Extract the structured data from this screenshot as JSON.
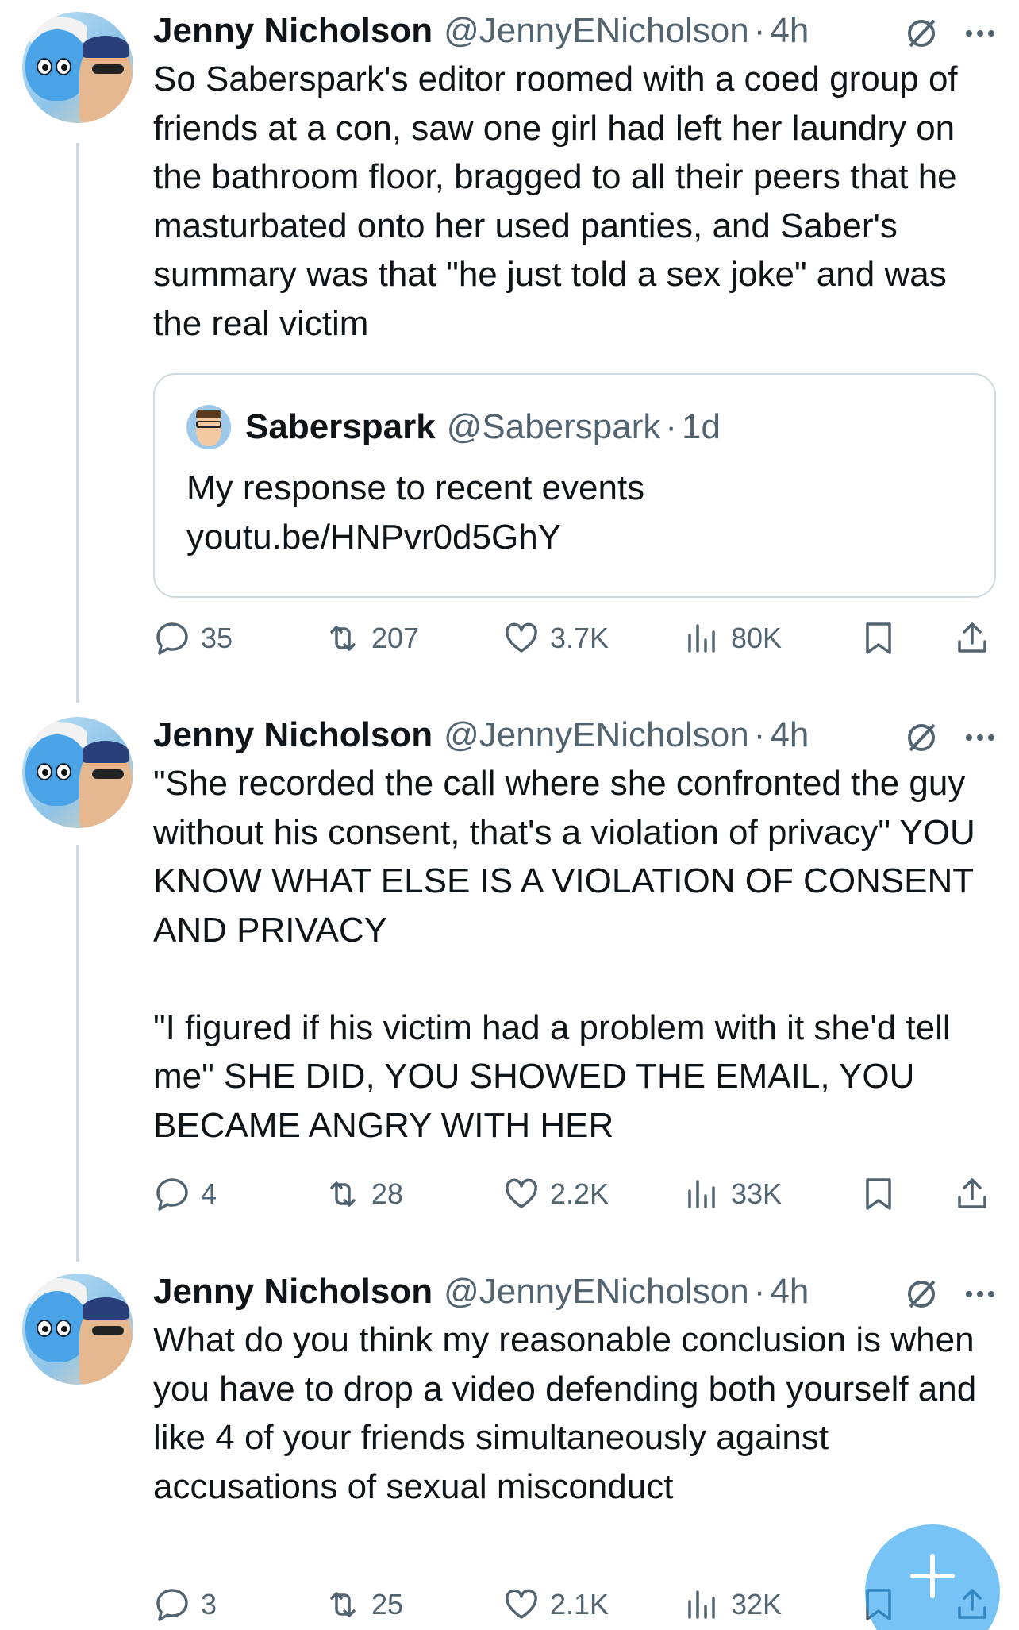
{
  "tweets": [
    {
      "author": "Jenny Nicholson",
      "handle": "@JennyENicholson",
      "separator": "·",
      "time": "4h",
      "text": "So Saberspark's editor roomed with a coed group of friends at a con, saw one girl had left her laundry on the bathroom floor, bragged to all their peers that he masturbated onto her used panties, and Saber's summary was that \"he just told a sex joke\" and was the real victim",
      "quote": {
        "author": "Saberspark",
        "handle": "@Saberspark",
        "separator": "·",
        "time": "1d",
        "text": "My response to recent events\nyoutu.be/HNPvr0d5GhY"
      },
      "stats": {
        "replies": "35",
        "reposts": "207",
        "likes": "3.7K",
        "views": "80K"
      }
    },
    {
      "author": "Jenny Nicholson",
      "handle": "@JennyENicholson",
      "separator": "·",
      "time": "4h",
      "text": "\"She recorded the call where she confronted the guy without his consent, that's a violation of privacy\" YOU KNOW WHAT ELSE IS A VIOLATION OF CONSENT AND PRIVACY\n\n\"I figured if his victim had a problem with it she'd tell me\" SHE DID, YOU SHOWED THE EMAIL, YOU BECAME ANGRY WITH HER",
      "stats": {
        "replies": "4",
        "reposts": "28",
        "likes": "2.2K",
        "views": "33K"
      }
    },
    {
      "author": "Jenny Nicholson",
      "handle": "@JennyENicholson",
      "separator": "·",
      "time": "4h",
      "text": "What do you think my reasonable conclusion is when you have to drop a video defending both yourself and like 4 of your friends simultaneously against accusations of sexual misconduct",
      "stats": {
        "replies": "3",
        "reposts": "25",
        "likes": "2.1K",
        "views": "32K"
      }
    }
  ],
  "icons": {
    "reply": "reply-icon",
    "repost": "repost-icon",
    "like": "heart-icon",
    "views": "views-icon",
    "bookmark": "bookmark-icon",
    "share": "share-icon",
    "grok": "grok-icon",
    "more": "more-icon",
    "compose": "compose-plus-icon"
  },
  "colors": {
    "text": "#0f1419",
    "secondary": "#536471",
    "border": "#cfd9de",
    "accent": "#1d9bf0"
  }
}
